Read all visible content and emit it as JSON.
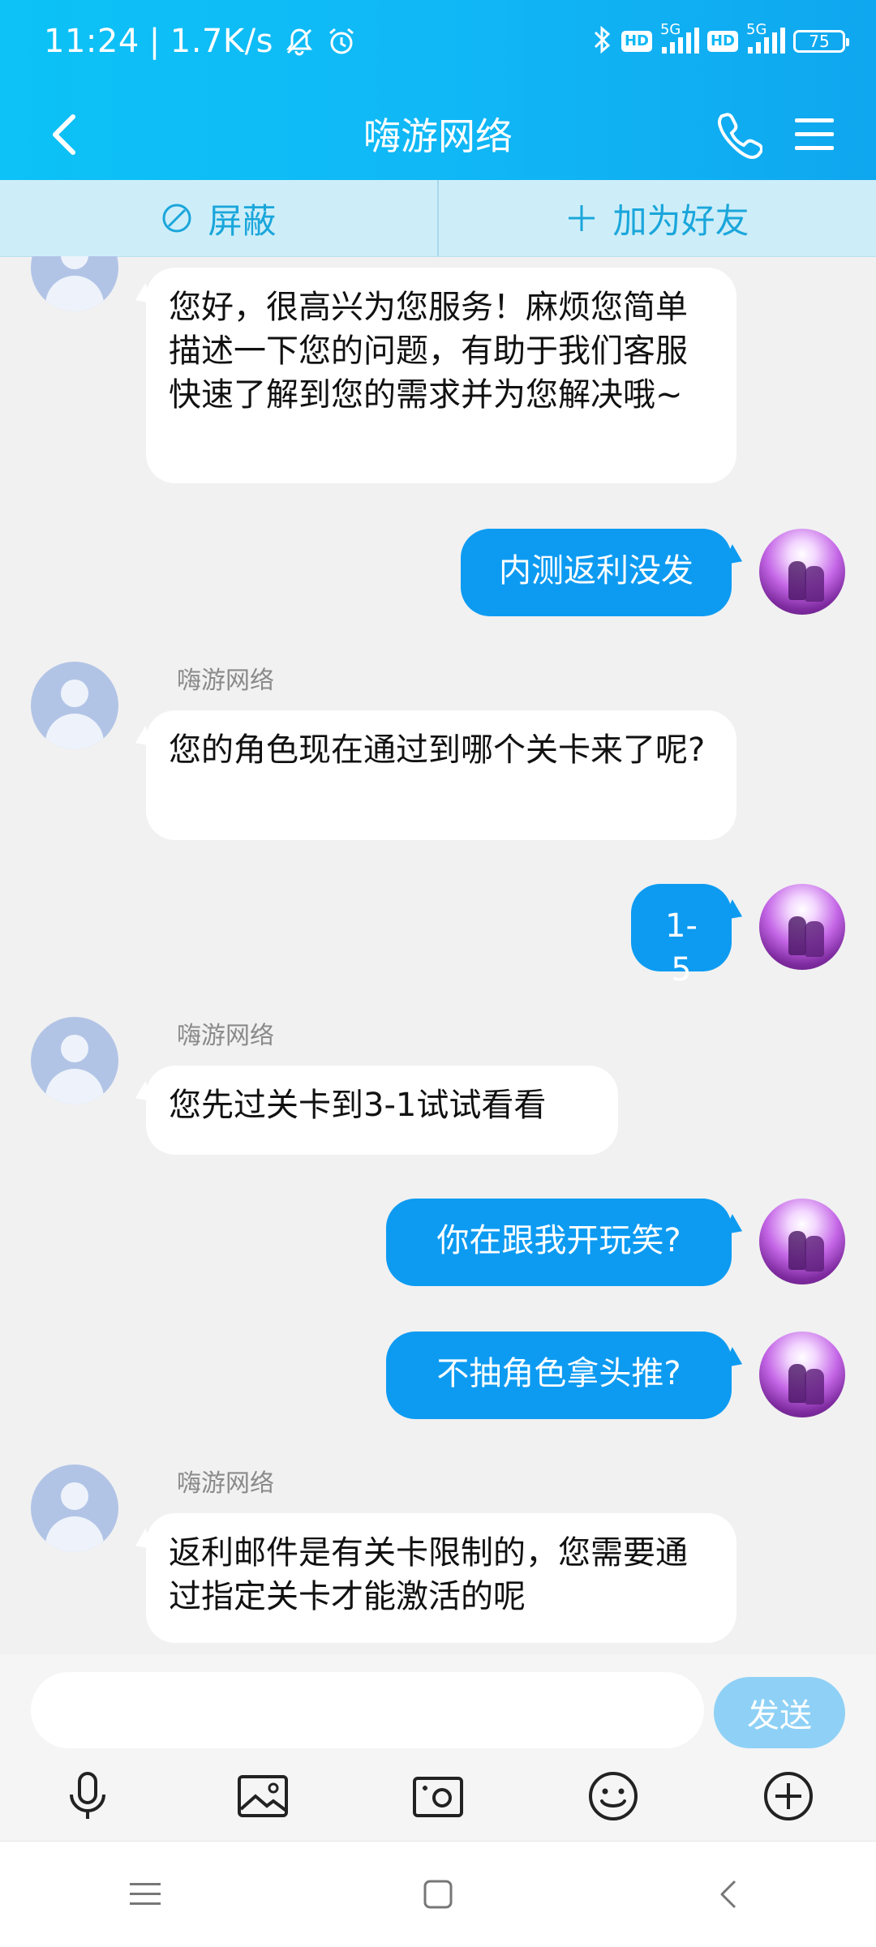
{
  "status": {
    "time": "11:24",
    "speed": "1.7K/s",
    "sim1_network": "5G",
    "sim2_network": "5G",
    "hd1": "HD",
    "hd2": "HD",
    "battery": "75"
  },
  "header": {
    "title": "嗨游网络"
  },
  "actions": {
    "block_label": "屏蔽",
    "add_friend_label": "加为好友"
  },
  "messages": [
    {
      "from": "them",
      "sender": "",
      "text": "您好，很高兴为您服务！麻烦您简单描述一下您的问题，有助于我们客服快速了解到您的需求并为您解决哦~"
    },
    {
      "from": "me",
      "text": "内测返利没发"
    },
    {
      "from": "them",
      "sender": "嗨游网络",
      "text": "您的角色现在通过到哪个关卡来了呢?"
    },
    {
      "from": "me",
      "text": "1-5"
    },
    {
      "from": "them",
      "sender": "嗨游网络",
      "text": "您先过关卡到3-1试试看看"
    },
    {
      "from": "me",
      "text": "你在跟我开玩笑?"
    },
    {
      "from": "me",
      "text": "不抽角色拿头推?"
    },
    {
      "from": "them",
      "sender": "嗨游网络",
      "text": "返利邮件是有关卡限制的，您需要通过指定关卡才能激活的呢"
    }
  ],
  "input": {
    "value": "",
    "send_label": "发送"
  },
  "toolbar_icons": [
    "microphone-icon",
    "image-icon",
    "camera-icon",
    "emoji-icon",
    "plus-circle-icon"
  ],
  "colors": {
    "header_bg": "#10b8f6",
    "outgoing_bubble": "#0d9bf2",
    "incoming_bubble": "#ffffff",
    "action_bar_bg": "#cdeef9",
    "send_button": "#8fd1f6"
  }
}
